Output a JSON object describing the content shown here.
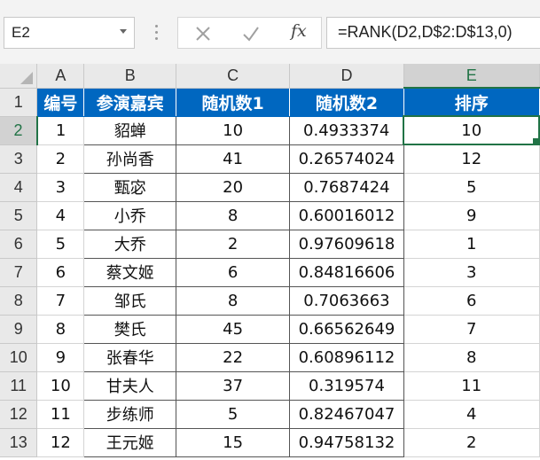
{
  "formula_bar": {
    "name_box": "E2",
    "formula": "=RANK(D2,D$2:D$13,0)",
    "cancel_icon": "close-icon",
    "enter_icon": "check-icon",
    "function_icon_label": "fx"
  },
  "columns": [
    "A",
    "B",
    "C",
    "D",
    "E"
  ],
  "rows": [
    "1",
    "2",
    "3",
    "4",
    "5",
    "6",
    "7",
    "8",
    "9",
    "10",
    "11",
    "12",
    "13"
  ],
  "table": {
    "headers": [
      "编号",
      "参演嘉宾",
      "随机数1",
      "随机数2",
      "排序"
    ],
    "data": [
      [
        "1",
        "貂蝉",
        "10",
        "0.4933374",
        "10"
      ],
      [
        "2",
        "孙尚香",
        "41",
        "0.26574024",
        "12"
      ],
      [
        "3",
        "甄宓",
        "20",
        "0.7687424",
        "5"
      ],
      [
        "4",
        "小乔",
        "8",
        "0.60016012",
        "9"
      ],
      [
        "5",
        "大乔",
        "2",
        "0.97609618",
        "1"
      ],
      [
        "6",
        "蔡文姬",
        "6",
        "0.84816606",
        "3"
      ],
      [
        "7",
        "邹氏",
        "8",
        "0.7063663",
        "6"
      ],
      [
        "8",
        "樊氏",
        "45",
        "0.66562649",
        "7"
      ],
      [
        "9",
        "张春华",
        "22",
        "0.60896112",
        "8"
      ],
      [
        "10",
        "甘夫人",
        "37",
        "0.319574",
        "11"
      ],
      [
        "11",
        "步练师",
        "5",
        "0.82467047",
        "4"
      ],
      [
        "12",
        "王元姬",
        "15",
        "0.94758132",
        "2"
      ]
    ]
  },
  "colors": {
    "header_bg": "#0067c0",
    "selection": "#217346"
  }
}
